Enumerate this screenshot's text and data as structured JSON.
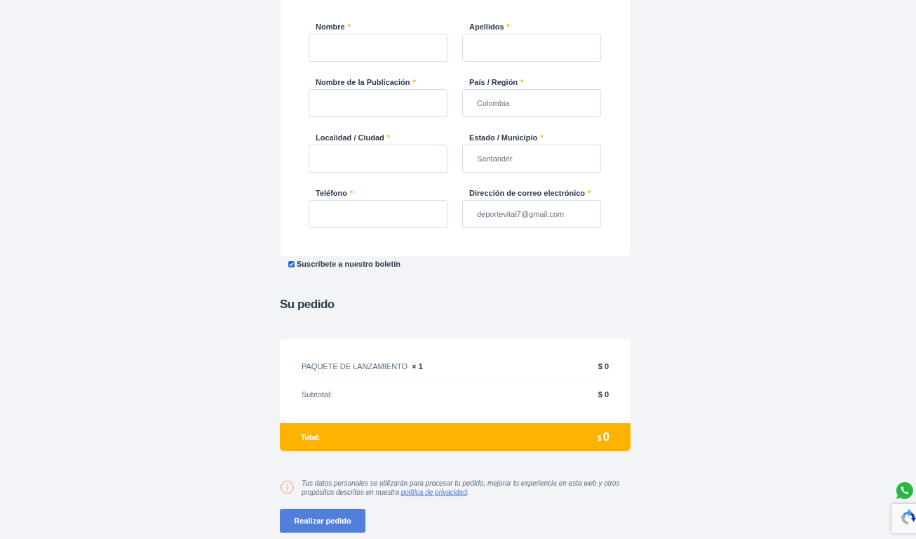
{
  "billing_form": {
    "fields": [
      {
        "label": "Nombre",
        "required_mark": "*"
      },
      {
        "label": "Apellidos",
        "required_mark": "*"
      },
      {
        "label": "Nombre de la Publicación",
        "required_mark": "*"
      },
      {
        "label": "País / Región",
        "required_mark": "*",
        "value": "Colombia"
      },
      {
        "label": "Localidad / Ciudad",
        "required_mark": "*"
      },
      {
        "label": "Estado / Municipio",
        "required_mark": "*",
        "value": "Santander"
      },
      {
        "label": "Teléfono",
        "required_mark": "*"
      },
      {
        "label": "Dirección de correo electrónico",
        "required_mark": "*",
        "value": "deportevital7@gmail.com"
      }
    ]
  },
  "newsletter": {
    "label": "Suscríbete a nuestro boletín",
    "checked": true
  },
  "order": {
    "heading": "Su pedido",
    "items": [
      {
        "name": "PAQUETE DE LANZAMIENTO",
        "quantity": "× 1",
        "price": "$ 0"
      }
    ],
    "subtotal": {
      "label": "Subtotal:",
      "value": "$ 0"
    },
    "total": {
      "label": "Total:",
      "currency": "$",
      "value": "0"
    }
  },
  "privacy_notice": {
    "text": "Tus datos personales se utilizarán para procesar tu pedido, mejorar tu experiencia en esta web y otros propósitos descritos en nuestra ",
    "link": "política de privacidad",
    "suffix": "."
  },
  "place_order_button": "Realizar pedido"
}
